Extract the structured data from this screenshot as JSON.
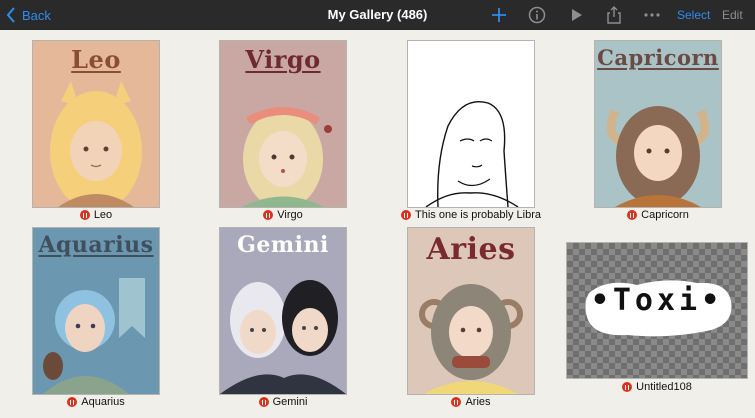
{
  "toolbar": {
    "back_label": "Back",
    "title": "My Gallery (486)",
    "select_label": "Select",
    "edit_label": "Edit",
    "icons": [
      "plus-icon",
      "info-icon",
      "play-icon",
      "share-icon",
      "more-icon"
    ]
  },
  "gallery": {
    "items": [
      {
        "title": "Leo",
        "caption": "Leo",
        "bg": "#e6b89a",
        "title_color": "#8a4e35"
      },
      {
        "title": "Virgo",
        "caption": "Virgo",
        "bg": "#c9a8a3",
        "title_color": "#6e2a30"
      },
      {
        "title": "",
        "caption": "This one is probably Libra",
        "bg": "#ffffff",
        "title_color": ""
      },
      {
        "title": "Capricorn",
        "caption": "Capricorn",
        "bg": "#a9c3c7",
        "title_color": "#6b4a43"
      },
      {
        "title": "Aquarius",
        "caption": "Aquarius",
        "bg": "#6b97b1",
        "title_color": "#3f4f5e"
      },
      {
        "title": "Gemini",
        "caption": "Gemini",
        "bg": "#a9a9bb",
        "title_color": "#ffffff"
      },
      {
        "title": "Aries",
        "caption": "Aries",
        "bg": "#dcc7b8",
        "title_color": "#7a2a2f"
      },
      {
        "title": "•Toxi•",
        "caption": "Untitled108",
        "bg": "#8a8a8a",
        "title_color": "#111111"
      }
    ]
  },
  "colors": {
    "accent": "#2f8cf0",
    "toolbar_bg": "#2a2a2a",
    "page_bg": "#f1efea",
    "status_red": "#d9321f"
  }
}
